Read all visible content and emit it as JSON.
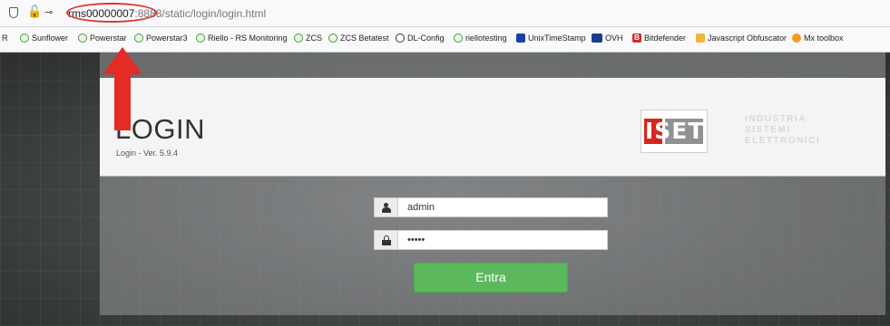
{
  "browser": {
    "url_host": "rms00000007",
    "url_port": ":8888",
    "url_path": "/static/login/login.html"
  },
  "bookmarks": [
    {
      "label": "R",
      "icon": "none"
    },
    {
      "label": "Sunflower",
      "icon": "green-leaf-icon"
    },
    {
      "label": "Powerstar",
      "icon": "green-leaf-icon"
    },
    {
      "label": "Powerstar3",
      "icon": "green-leaf-icon"
    },
    {
      "label": "Riello - RS Monitoring",
      "icon": "green-leaf-icon"
    },
    {
      "label": "ZCS",
      "icon": "green-leaf-icon"
    },
    {
      "label": "ZCS Betatest",
      "icon": "green-leaf-icon"
    },
    {
      "label": "DL-Config",
      "icon": "globe-icon"
    },
    {
      "label": "riellotesting",
      "icon": "green-leaf-icon"
    },
    {
      "label": "UnixTimeStamp",
      "icon": "unix-icon"
    },
    {
      "label": "OVH",
      "icon": "ovh-icon"
    },
    {
      "label": "Bitdefender",
      "icon": "bitdefender-icon"
    },
    {
      "label": "Javascript Obfuscator",
      "icon": "js-icon"
    },
    {
      "label": "Mx toolbox",
      "icon": "mxtoolbox-icon"
    }
  ],
  "header": {
    "title": "LOGIN",
    "version": "Login - Ver. 5.9.4",
    "logo_text": "ISET",
    "logo_words": "INDUSTRIA\nSISTEMI\nELETTRONICI"
  },
  "form": {
    "username_value": "admin",
    "password_value": "•••••",
    "submit_label": "Entra"
  },
  "colors": {
    "button_green": "#5cb85c",
    "logo_red": "#d8251d",
    "annotation_red": "#e52b25"
  }
}
